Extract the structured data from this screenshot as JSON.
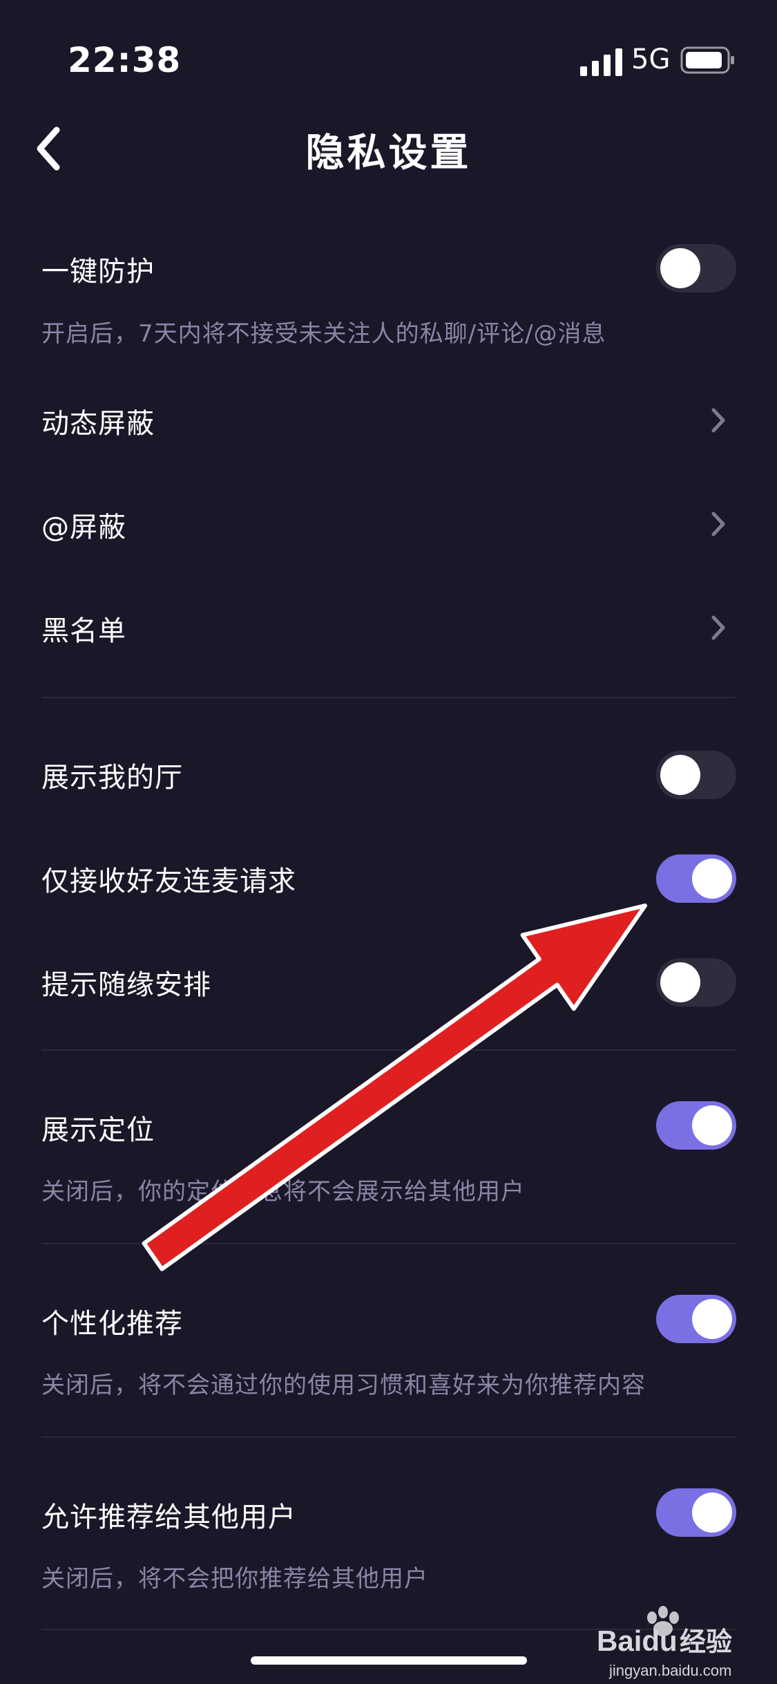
{
  "status_bar": {
    "time": "22:38",
    "network": "5G"
  },
  "header": {
    "title": "隐私设置"
  },
  "items": {
    "one_key_protect": {
      "label": "一键防护",
      "desc": "开启后，7天内将不接受未关注人的私聊/评论/@消息",
      "on": false
    },
    "dynamic_block": {
      "label": "动态屏蔽"
    },
    "at_block": {
      "label": "@屏蔽"
    },
    "blacklist": {
      "label": "黑名单"
    },
    "show_my_hall": {
      "label": "展示我的厅",
      "on": false
    },
    "friends_mic_only": {
      "label": "仅接收好友连麦请求",
      "on": true
    },
    "random_arrange_hint": {
      "label": "提示随缘安排",
      "on": false
    },
    "show_location": {
      "label": "展示定位",
      "desc": "关闭后，你的定位信息将不会展示给其他用户",
      "on": true
    },
    "personalized_recommend": {
      "label": "个性化推荐",
      "desc": "关闭后，将不会通过你的使用习惯和喜好来为你推荐内容",
      "on": true
    },
    "allow_recommend": {
      "label": "允许推荐给其他用户",
      "desc": "关闭后，将不会把你推荐给其他用户",
      "on": true
    }
  },
  "watermark": {
    "brand": "Baidu",
    "text": "经验",
    "url": "jingyan.baidu.com"
  },
  "colors": {
    "background": "#1a1728",
    "toggle_on": "#7a6fe3",
    "toggle_off": "#2f2c3d",
    "subtext": "#8a85a6",
    "annotation_arrow": "#e02020"
  }
}
